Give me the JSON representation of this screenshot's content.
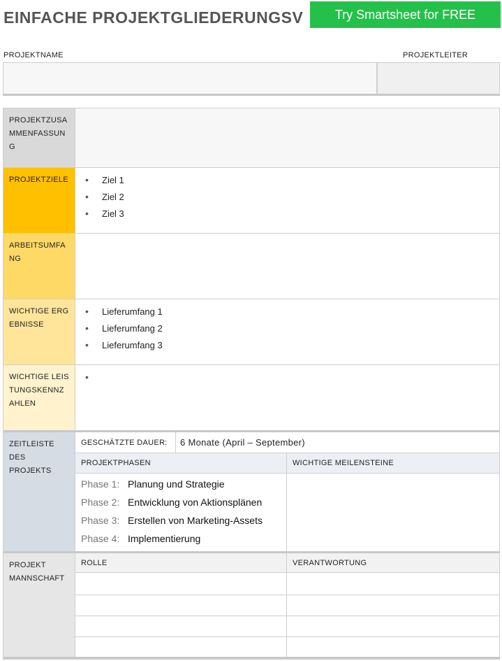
{
  "title": "EINFACHE PROJEKTGLIEDERUNGSV",
  "cta_label": "Try Smartsheet for FREE",
  "fields": {
    "project_name_label": "PROJEKTNAME",
    "project_lead_label": "PROJEKTLEITER"
  },
  "sections": {
    "summary": {
      "label": "PROJEKTZUSAMMENFASSUNG"
    },
    "goals": {
      "label": "PROJEKTZIELE",
      "items": [
        "Ziel 1",
        "Ziel 2",
        "Ziel 3"
      ]
    },
    "scope": {
      "label": "ARBEITSUMFANG"
    },
    "deliverables": {
      "label": "WICHTIGE ERGEBNISSE",
      "items": [
        "Lieferumfang 1",
        "Lieferumfang 2",
        "Lieferumfang 3"
      ]
    },
    "kpis": {
      "label": "WICHTIGE LEISTUNGSKENNZAHLEN"
    },
    "timeline": {
      "label": "ZEITLEISTE DES PROJEKTS",
      "duration_label": "GESCHÄTZTE DAUER:",
      "duration_value": "6 Monate (April – September)",
      "phases_header": "PROJEKTPHASEN",
      "milestones_header": "WICHTIGE MEILENSTEINE",
      "phases": [
        {
          "num": "Phase 1:",
          "text": "Planung und Strategie"
        },
        {
          "num": "Phase 2:",
          "text": "Entwicklung von Aktionsplänen"
        },
        {
          "num": "Phase 3:",
          "text": "Erstellen von Marketing-Assets"
        },
        {
          "num": "Phase 4:",
          "text": "Implementierung"
        }
      ]
    },
    "team": {
      "label": "PROJEKT MANNSCHAFT",
      "role_header": "ROLLE",
      "responsibility_header": "VERANTWORTUNG"
    }
  },
  "colors": {
    "cta": "#24c14a",
    "summary": "#d9d9d9",
    "goals": "#ffc000",
    "scope": "#ffd966",
    "deliverables": "#ffe599",
    "kpis": "#fff2cc",
    "timeline": "#d6dce4",
    "team": "#e7e6e6"
  }
}
